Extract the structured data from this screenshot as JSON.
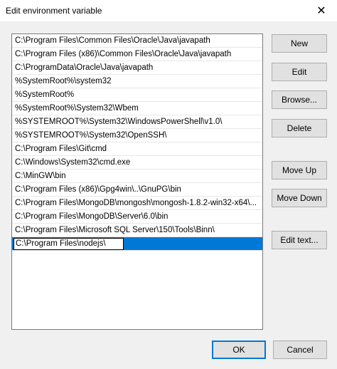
{
  "window": {
    "title": "Edit environment variable",
    "close_glyph": "✕"
  },
  "list": {
    "items": [
      "C:\\Program Files\\Common Files\\Oracle\\Java\\javapath",
      "C:\\Program Files (x86)\\Common Files\\Oracle\\Java\\javapath",
      "C:\\ProgramData\\Oracle\\Java\\javapath",
      "%SystemRoot%\\system32",
      "%SystemRoot%",
      "%SystemRoot%\\System32\\Wbem",
      "%SYSTEMROOT%\\System32\\WindowsPowerShell\\v1.0\\",
      "%SYSTEMROOT%\\System32\\OpenSSH\\",
      "C:\\Program Files\\Git\\cmd",
      "C:\\Windows\\System32\\cmd.exe",
      "C:\\MinGW\\bin",
      "C:\\Program Files (x86)\\Gpg4win\\..\\GnuPG\\bin",
      "C:\\Program Files\\MongoDB\\mongosh\\mongosh-1.8.2-win32-x64\\...",
      "C:\\Program Files\\MongoDB\\Server\\6.0\\bin",
      "C:\\Program Files\\Microsoft SQL Server\\150\\Tools\\Binn\\"
    ],
    "editing_value": "C:\\Program Files\\nodejs\\"
  },
  "buttons": {
    "new": "New",
    "edit": "Edit",
    "browse": "Browse...",
    "delete": "Delete",
    "move_up": "Move Up",
    "move_down": "Move Down",
    "edit_text": "Edit text...",
    "ok": "OK",
    "cancel": "Cancel"
  }
}
